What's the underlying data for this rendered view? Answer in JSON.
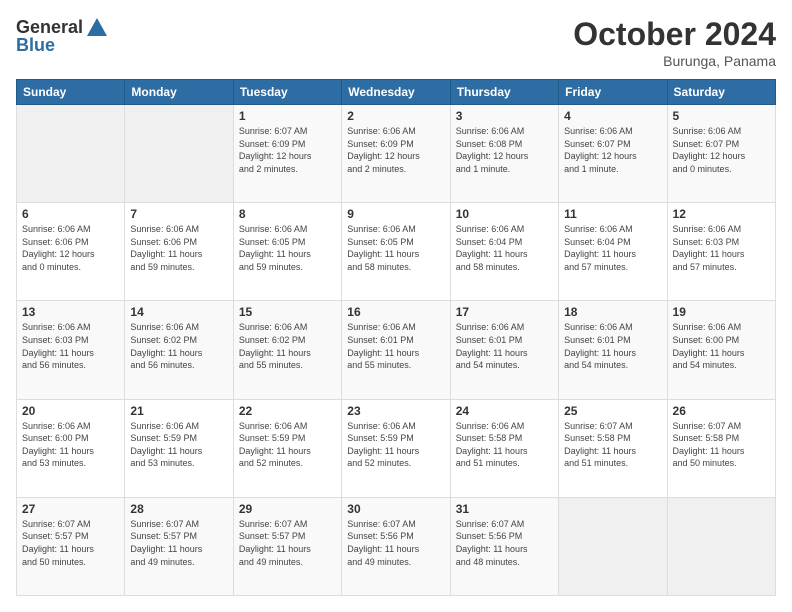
{
  "logo": {
    "text_general": "General",
    "text_blue": "Blue"
  },
  "header": {
    "month": "October 2024",
    "location": "Burunga, Panama"
  },
  "days_of_week": [
    "Sunday",
    "Monday",
    "Tuesday",
    "Wednesday",
    "Thursday",
    "Friday",
    "Saturday"
  ],
  "weeks": [
    [
      {
        "day": "",
        "info": ""
      },
      {
        "day": "",
        "info": ""
      },
      {
        "day": "1",
        "info": "Sunrise: 6:07 AM\nSunset: 6:09 PM\nDaylight: 12 hours\nand 2 minutes."
      },
      {
        "day": "2",
        "info": "Sunrise: 6:06 AM\nSunset: 6:09 PM\nDaylight: 12 hours\nand 2 minutes."
      },
      {
        "day": "3",
        "info": "Sunrise: 6:06 AM\nSunset: 6:08 PM\nDaylight: 12 hours\nand 1 minute."
      },
      {
        "day": "4",
        "info": "Sunrise: 6:06 AM\nSunset: 6:07 PM\nDaylight: 12 hours\nand 1 minute."
      },
      {
        "day": "5",
        "info": "Sunrise: 6:06 AM\nSunset: 6:07 PM\nDaylight: 12 hours\nand 0 minutes."
      }
    ],
    [
      {
        "day": "6",
        "info": "Sunrise: 6:06 AM\nSunset: 6:06 PM\nDaylight: 12 hours\nand 0 minutes."
      },
      {
        "day": "7",
        "info": "Sunrise: 6:06 AM\nSunset: 6:06 PM\nDaylight: 11 hours\nand 59 minutes."
      },
      {
        "day": "8",
        "info": "Sunrise: 6:06 AM\nSunset: 6:05 PM\nDaylight: 11 hours\nand 59 minutes."
      },
      {
        "day": "9",
        "info": "Sunrise: 6:06 AM\nSunset: 6:05 PM\nDaylight: 11 hours\nand 58 minutes."
      },
      {
        "day": "10",
        "info": "Sunrise: 6:06 AM\nSunset: 6:04 PM\nDaylight: 11 hours\nand 58 minutes."
      },
      {
        "day": "11",
        "info": "Sunrise: 6:06 AM\nSunset: 6:04 PM\nDaylight: 11 hours\nand 57 minutes."
      },
      {
        "day": "12",
        "info": "Sunrise: 6:06 AM\nSunset: 6:03 PM\nDaylight: 11 hours\nand 57 minutes."
      }
    ],
    [
      {
        "day": "13",
        "info": "Sunrise: 6:06 AM\nSunset: 6:03 PM\nDaylight: 11 hours\nand 56 minutes."
      },
      {
        "day": "14",
        "info": "Sunrise: 6:06 AM\nSunset: 6:02 PM\nDaylight: 11 hours\nand 56 minutes."
      },
      {
        "day": "15",
        "info": "Sunrise: 6:06 AM\nSunset: 6:02 PM\nDaylight: 11 hours\nand 55 minutes."
      },
      {
        "day": "16",
        "info": "Sunrise: 6:06 AM\nSunset: 6:01 PM\nDaylight: 11 hours\nand 55 minutes."
      },
      {
        "day": "17",
        "info": "Sunrise: 6:06 AM\nSunset: 6:01 PM\nDaylight: 11 hours\nand 54 minutes."
      },
      {
        "day": "18",
        "info": "Sunrise: 6:06 AM\nSunset: 6:01 PM\nDaylight: 11 hours\nand 54 minutes."
      },
      {
        "day": "19",
        "info": "Sunrise: 6:06 AM\nSunset: 6:00 PM\nDaylight: 11 hours\nand 54 minutes."
      }
    ],
    [
      {
        "day": "20",
        "info": "Sunrise: 6:06 AM\nSunset: 6:00 PM\nDaylight: 11 hours\nand 53 minutes."
      },
      {
        "day": "21",
        "info": "Sunrise: 6:06 AM\nSunset: 5:59 PM\nDaylight: 11 hours\nand 53 minutes."
      },
      {
        "day": "22",
        "info": "Sunrise: 6:06 AM\nSunset: 5:59 PM\nDaylight: 11 hours\nand 52 minutes."
      },
      {
        "day": "23",
        "info": "Sunrise: 6:06 AM\nSunset: 5:59 PM\nDaylight: 11 hours\nand 52 minutes."
      },
      {
        "day": "24",
        "info": "Sunrise: 6:06 AM\nSunset: 5:58 PM\nDaylight: 11 hours\nand 51 minutes."
      },
      {
        "day": "25",
        "info": "Sunrise: 6:07 AM\nSunset: 5:58 PM\nDaylight: 11 hours\nand 51 minutes."
      },
      {
        "day": "26",
        "info": "Sunrise: 6:07 AM\nSunset: 5:58 PM\nDaylight: 11 hours\nand 50 minutes."
      }
    ],
    [
      {
        "day": "27",
        "info": "Sunrise: 6:07 AM\nSunset: 5:57 PM\nDaylight: 11 hours\nand 50 minutes."
      },
      {
        "day": "28",
        "info": "Sunrise: 6:07 AM\nSunset: 5:57 PM\nDaylight: 11 hours\nand 49 minutes."
      },
      {
        "day": "29",
        "info": "Sunrise: 6:07 AM\nSunset: 5:57 PM\nDaylight: 11 hours\nand 49 minutes."
      },
      {
        "day": "30",
        "info": "Sunrise: 6:07 AM\nSunset: 5:56 PM\nDaylight: 11 hours\nand 49 minutes."
      },
      {
        "day": "31",
        "info": "Sunrise: 6:07 AM\nSunset: 5:56 PM\nDaylight: 11 hours\nand 48 minutes."
      },
      {
        "day": "",
        "info": ""
      },
      {
        "day": "",
        "info": ""
      }
    ]
  ]
}
